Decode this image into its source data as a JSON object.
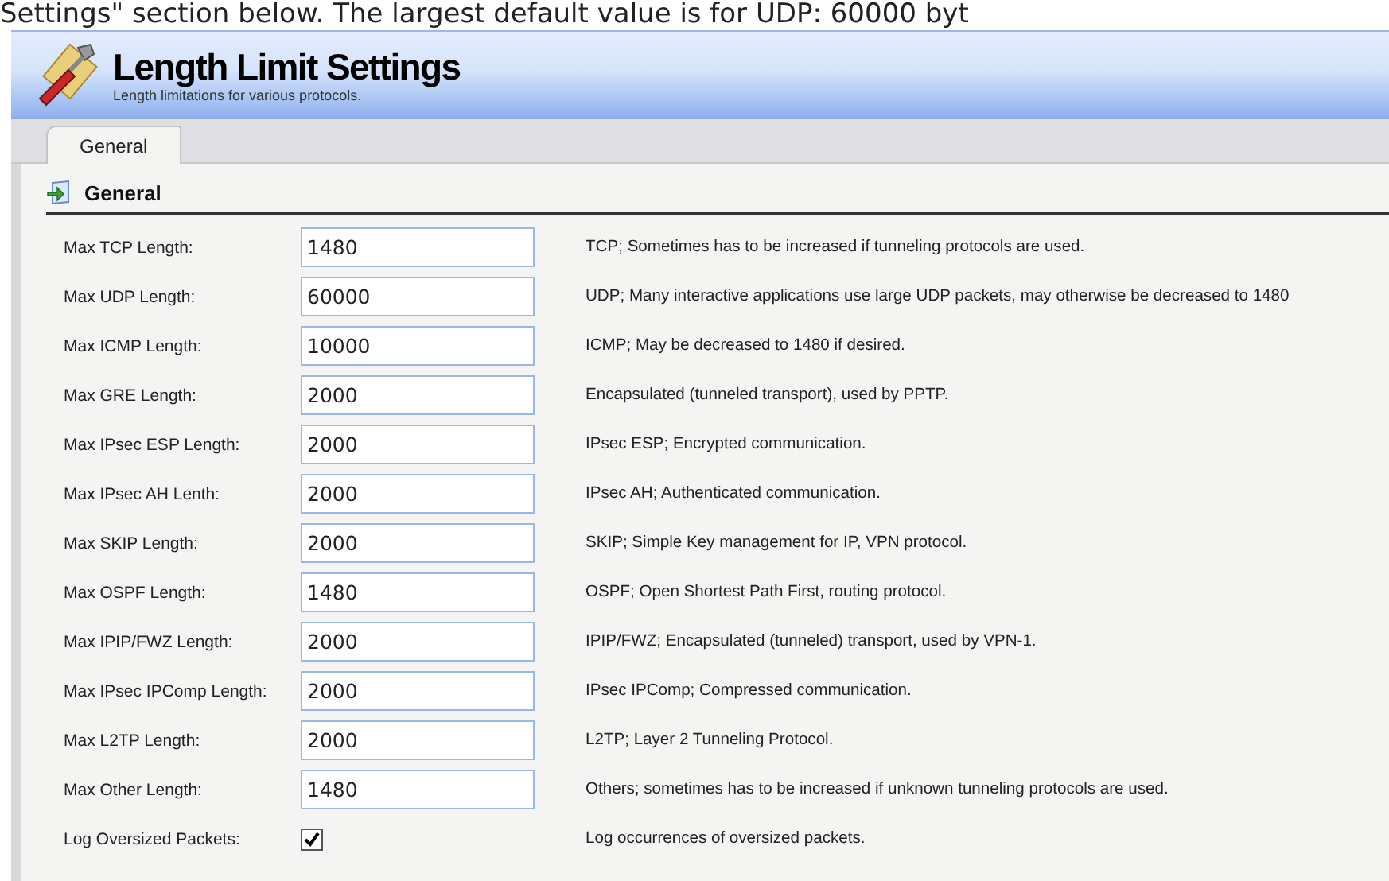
{
  "intro_text": "Settings\" section below. The largest default value is for UDP: 60000 byt",
  "header": {
    "title": "Length Limit Settings",
    "subtitle": "Length limitations for various protocols."
  },
  "tabs": [
    {
      "label": "General",
      "selected": true
    }
  ],
  "section": {
    "title": "General"
  },
  "rows": [
    {
      "kind": "field",
      "label": "Max TCP Length:",
      "value": "1480",
      "description": "TCP; Sometimes has to be increased if tunneling protocols are used."
    },
    {
      "kind": "field",
      "label": "Max UDP Length:",
      "value": "60000",
      "description": "UDP; Many interactive applications use large UDP packets, may otherwise be decreased to 1480"
    },
    {
      "kind": "field",
      "label": "Max ICMP Length:",
      "value": "10000",
      "description": "ICMP; May be decreased to 1480 if desired."
    },
    {
      "kind": "field",
      "label": "Max GRE Length:",
      "value": "2000",
      "description": "Encapsulated (tunneled transport), used by PPTP."
    },
    {
      "kind": "field",
      "label": "Max IPsec ESP Length:",
      "value": "2000",
      "description": "IPsec ESP; Encrypted communication."
    },
    {
      "kind": "field",
      "label": "Max IPsec AH Lenth:",
      "value": "2000",
      "description": "IPsec AH; Authenticated communication."
    },
    {
      "kind": "field",
      "label": "Max SKIP Length:",
      "value": "2000",
      "description": "SKIP; Simple Key management for IP, VPN protocol."
    },
    {
      "kind": "field",
      "label": "Max OSPF Length:",
      "value": "1480",
      "description": "OSPF; Open Shortest Path First, routing protocol."
    },
    {
      "kind": "field",
      "label": "Max IPIP/FWZ Length:",
      "value": "2000",
      "description": "IPIP/FWZ; Encapsulated (tunneled) transport, used by VPN-1."
    },
    {
      "kind": "field",
      "label": "Max IPsec IPComp Length:",
      "value": "2000",
      "description": "IPsec IPComp; Compressed communication."
    },
    {
      "kind": "field",
      "label": "Max L2TP Length:",
      "value": "2000",
      "description": "L2TP; Layer 2 Tunneling Protocol."
    },
    {
      "kind": "field",
      "label": "Max Other Length:",
      "value": "1480",
      "description": "Others; sometimes has to be increased if unknown tunneling protocols are used."
    },
    {
      "kind": "checkbox",
      "label": "Log Oversized Packets:",
      "checked": true,
      "description": "Log occurrences of oversized packets."
    }
  ]
}
